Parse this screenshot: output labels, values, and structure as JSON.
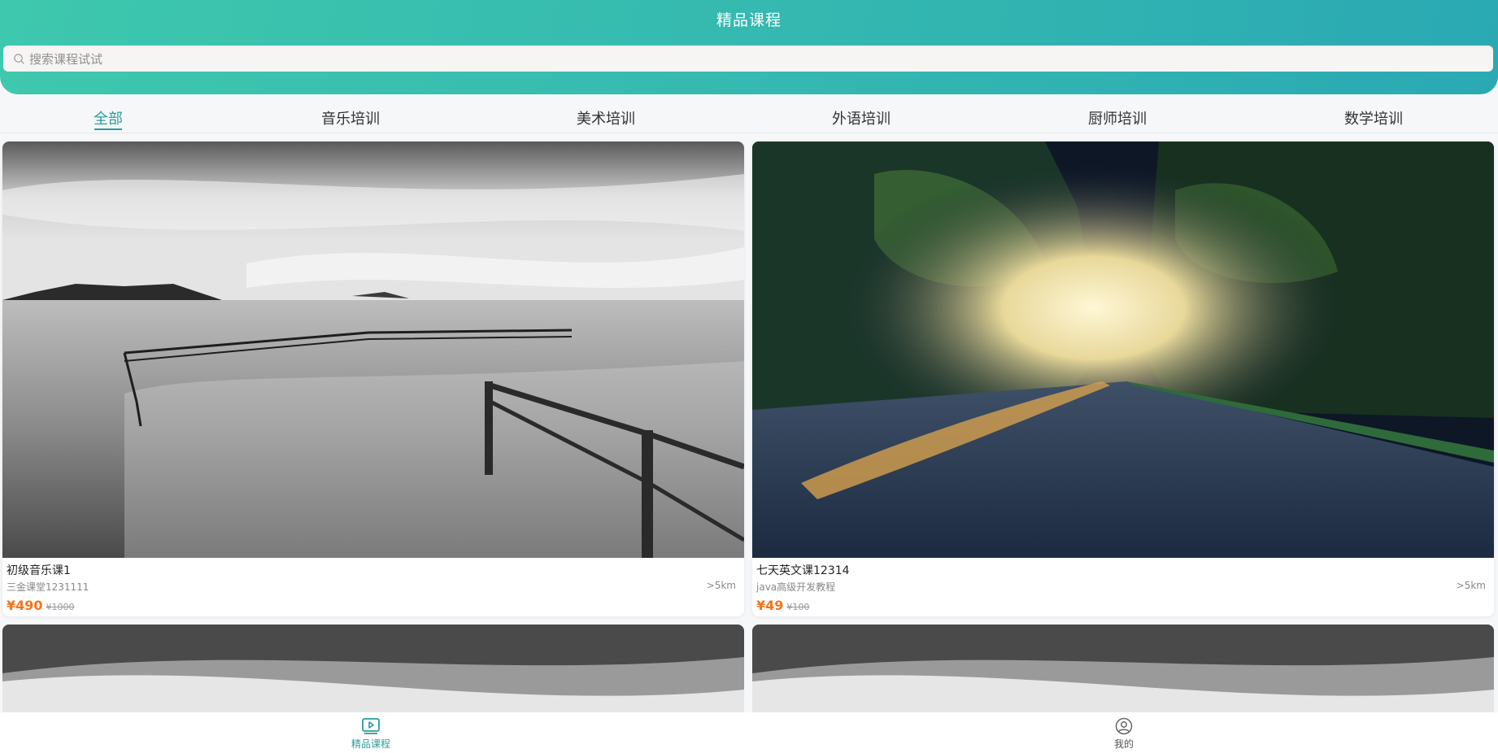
{
  "header": {
    "title": "精品课程"
  },
  "search": {
    "placeholder": "搜索课程试试",
    "icon": "search-icon"
  },
  "tabs": [
    {
      "label": "全部",
      "active": true
    },
    {
      "label": "音乐培训",
      "active": false
    },
    {
      "label": "美术培训",
      "active": false
    },
    {
      "label": "外语培训",
      "active": false
    },
    {
      "label": "厨师培训",
      "active": false
    },
    {
      "label": "数学培训",
      "active": false
    }
  ],
  "courses": [
    {
      "title": "初级音乐课1",
      "provider": "三金课堂1231111",
      "distance": ">5km",
      "price": "¥490",
      "original_price": "¥1000",
      "image": "black-and-white seascape with railing"
    },
    {
      "title": "七天英文课12314",
      "provider": "java高级开发教程",
      "distance": ">5km",
      "price": "¥49",
      "original_price": "¥100",
      "image": "tree-lined road at sunrise"
    }
  ],
  "bottom_nav": [
    {
      "label": "精品课程",
      "icon": "video-play-icon",
      "active": true
    },
    {
      "label": "我的",
      "icon": "user-circle-icon",
      "active": false
    }
  ],
  "colors": {
    "accent": "#2a9d9a",
    "price": "#f5731b",
    "header_start": "#3ec8ad",
    "header_end": "#2aa9b3"
  }
}
